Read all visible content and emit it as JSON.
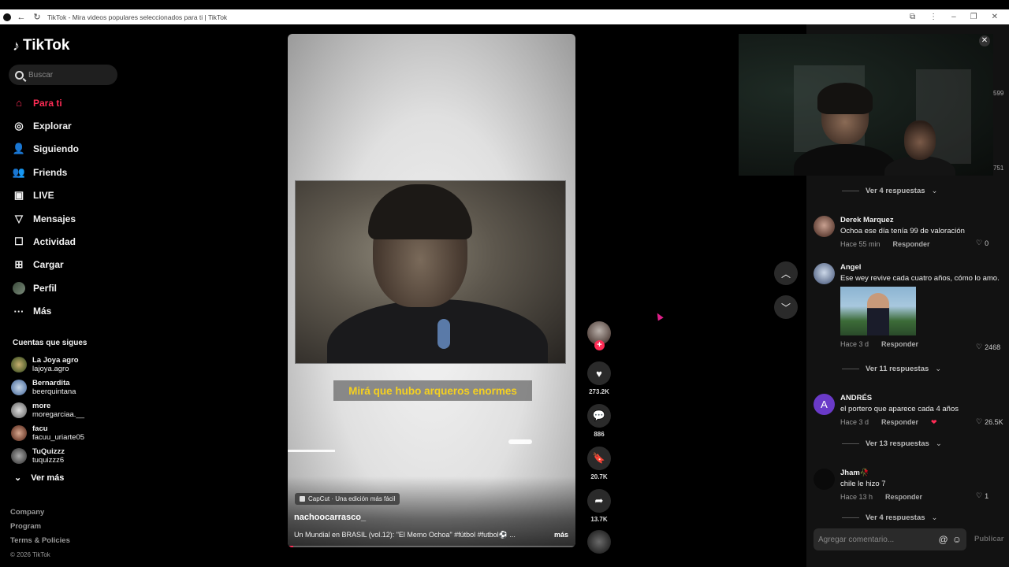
{
  "browser": {
    "title": "TikTok - Mira videos populares seleccionados para ti | TikTok"
  },
  "sidebar": {
    "logo": "TikTok",
    "search_placeholder": "Buscar",
    "nav": [
      {
        "label": "Para ti",
        "icon": "home-icon",
        "active": true
      },
      {
        "label": "Explorar",
        "icon": "compass-icon"
      },
      {
        "label": "Siguiendo",
        "icon": "following-icon"
      },
      {
        "label": "Friends",
        "icon": "friends-icon"
      },
      {
        "label": "LIVE",
        "icon": "live-icon"
      },
      {
        "label": "Mensajes",
        "icon": "messages-icon"
      },
      {
        "label": "Actividad",
        "icon": "activity-icon"
      },
      {
        "label": "Cargar",
        "icon": "upload-icon"
      },
      {
        "label": "Perfil",
        "icon": "profile-avatar"
      },
      {
        "label": "Más",
        "icon": "more-icon"
      }
    ],
    "following_title": "Cuentas que sigues",
    "following": [
      {
        "name": "La Joya agro",
        "handle": "lajoya.agro"
      },
      {
        "name": "Bernardita",
        "handle": "beerquintana"
      },
      {
        "name": "more",
        "handle": "moregarciaa.__"
      },
      {
        "name": "facu",
        "handle": "facuu_uriarte05"
      },
      {
        "name": "TuQuizzz",
        "handle": "tuquizzz6"
      }
    ],
    "see_more": "Ver más",
    "footer": {
      "company": "Company",
      "program": "Program",
      "terms": "Terms & Policies",
      "copyright": "© 2026 TikTok"
    }
  },
  "video": {
    "caption_overlay": "Mirá que hubo arqueros enormes",
    "capcut_label": "CapCut · Una edición más fácil",
    "author": "nachoocarrasco_",
    "description": "Un Mundial en BRASIL (vol.12): \"El Memo Ochoa\" #fútbol #futbol⚽ ...",
    "more": "más",
    "progress": 0.02
  },
  "actions": {
    "likes": "273.2K",
    "comments": "886",
    "saves": "20.7K",
    "shares": "13.7K"
  },
  "comments": {
    "edge_numbers": [
      "599",
      "751"
    ],
    "reply_links": [
      "Ver 4 respuestas",
      "Ver 11 respuestas",
      "Ver 13 respuestas",
      "Ver 4 respuestas"
    ],
    "items": [
      {
        "name": "Derek Marquez",
        "text": "Ochoa ese día tenía 99 de valoración",
        "time": "Hace 55 min",
        "reply": "Responder",
        "likes": "0"
      },
      {
        "name": "Angel",
        "text": "Ese wey revive cada cuatro años, cómo lo amo.",
        "time": "Hace 3 d",
        "reply": "Responder",
        "likes": "2468"
      },
      {
        "name": "ANDRÉS",
        "initial": "A",
        "text": "el portero que aparece cada 4 años",
        "time": "Hace 3 d",
        "reply": "Responder",
        "likes": "26.5K"
      },
      {
        "name": "Jham🥀",
        "text": "chile le hizo 7",
        "time": "Hace 13 h",
        "reply": "Responder",
        "likes": "1"
      }
    ],
    "add_placeholder": "Agregar comentario...",
    "publish": "Publicar"
  }
}
